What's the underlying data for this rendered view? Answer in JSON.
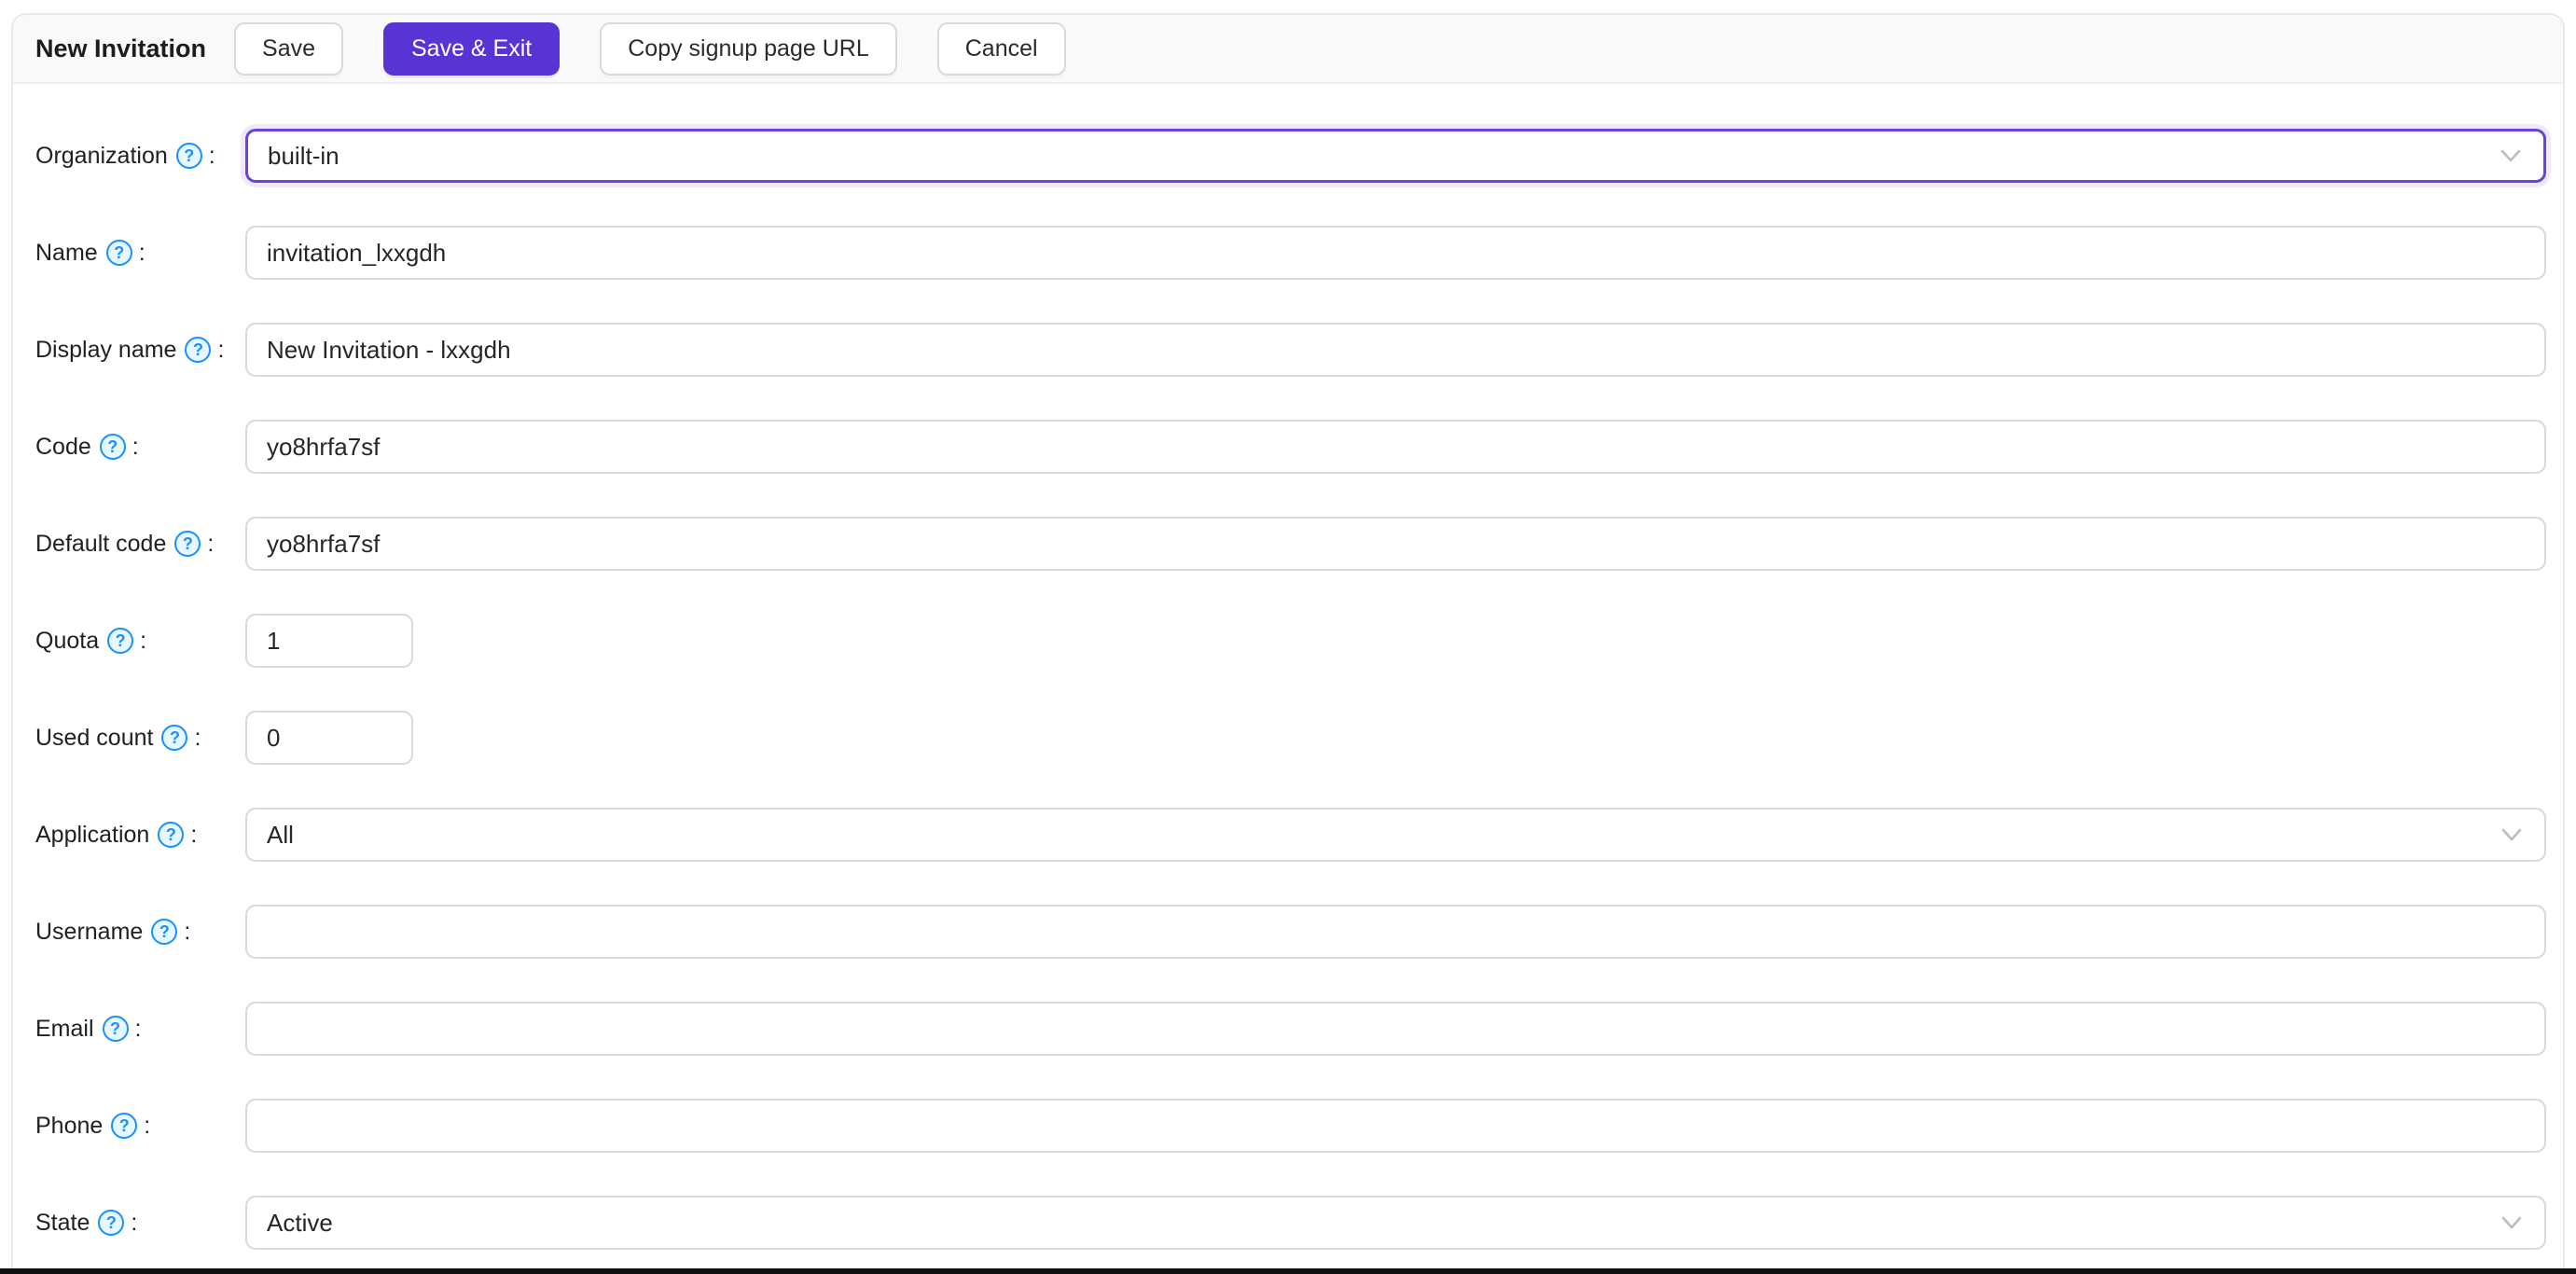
{
  "theme": {
    "accent": "#5734d3",
    "help_icon_color": "#1890ff",
    "help_icon_fill": "#e6f7ff",
    "input_border": "#d9d9d9",
    "frame_bottom_color": "#101010"
  },
  "header": {
    "title": "New Invitation",
    "buttons": [
      {
        "label": "Save",
        "variant": "default"
      },
      {
        "label": "Save & Exit",
        "variant": "primary"
      },
      {
        "label": "Copy signup page URL",
        "variant": "default"
      },
      {
        "label": "Cancel",
        "variant": "default"
      }
    ]
  },
  "form": {
    "colon": ":",
    "help_glyph": "?",
    "rows": [
      {
        "label": "Organization",
        "control": "select",
        "value": "built-in",
        "state": "focused",
        "width": "full"
      },
      {
        "label": "Name",
        "control": "input",
        "value": "invitation_lxxgdh",
        "width": "full"
      },
      {
        "label": "Display name",
        "control": "input",
        "value": "New Invitation - lxxgdh",
        "width": "full"
      },
      {
        "label": "Code",
        "control": "input",
        "value": "yo8hrfa7sf",
        "width": "full"
      },
      {
        "label": "Default code",
        "control": "input",
        "value": "yo8hrfa7sf",
        "width": "full"
      },
      {
        "label": "Quota",
        "control": "input",
        "value": "1",
        "width": "small"
      },
      {
        "label": "Used count",
        "control": "input",
        "value": "0",
        "width": "small"
      },
      {
        "label": "Application",
        "control": "select",
        "value": "All",
        "width": "full"
      },
      {
        "label": "Username",
        "control": "input",
        "value": "",
        "width": "full"
      },
      {
        "label": "Email",
        "control": "input",
        "value": "",
        "width": "full"
      },
      {
        "label": "Phone",
        "control": "input",
        "value": "",
        "width": "full"
      },
      {
        "label": "State",
        "control": "select",
        "value": "Active",
        "width": "full"
      }
    ]
  }
}
